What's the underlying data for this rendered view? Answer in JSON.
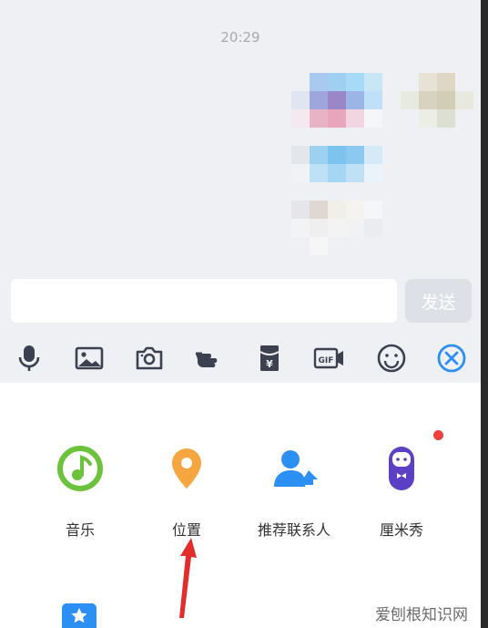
{
  "chat": {
    "timestamp": "20:29"
  },
  "input": {
    "value": "",
    "placeholder": "",
    "send_label": "发送"
  },
  "toolbar": {
    "icons": [
      "microphone-icon",
      "image-icon",
      "camera-icon",
      "hand-icon",
      "red-packet-icon",
      "gif-icon",
      "emoji-icon",
      "close-circle-icon"
    ]
  },
  "features": [
    {
      "label": "音乐",
      "icon": "music-icon"
    },
    {
      "label": "位置",
      "icon": "location-pin-icon"
    },
    {
      "label": "推荐联系人",
      "icon": "recommend-contact-icon"
    },
    {
      "label": "厘米秀",
      "icon": "cmshow-avatar-icon"
    }
  ],
  "colors": {
    "chat_bg": "#eef0f4",
    "accent_blue": "#2c8ff3",
    "music_green": "#6cc23a",
    "location_orange": "#f6a640",
    "cmshow_purple": "#5b3fc4",
    "red_dot": "#f1403c",
    "arrow_red": "#e32c2c"
  },
  "watermark": "爱刨根知识网"
}
